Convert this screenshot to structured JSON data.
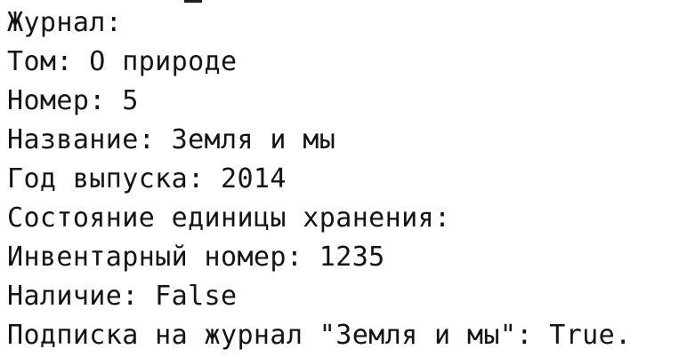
{
  "console": {
    "lines": [
      "Журнал:",
      "Том: О природе",
      "Номер: 5",
      "Название: Земля и мы",
      "Год выпуска: 2014",
      "Состояние единицы хранения:",
      "Инвентарный номер: 1235",
      "Наличие: False",
      "Подписка на журнал \"Земля и мы\": True."
    ]
  },
  "colors": {
    "background": "#ffffff",
    "text": "#141414"
  }
}
